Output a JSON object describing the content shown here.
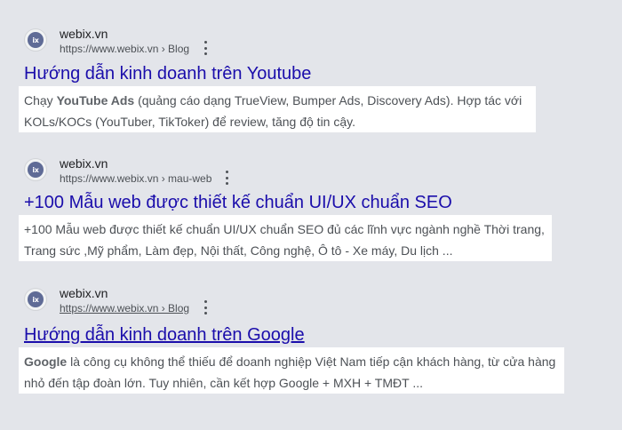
{
  "results": [
    {
      "site_name": "webix.vn",
      "url_text": "https://www.webix.vn › Blog",
      "favicon_text": "ix",
      "title": "Hướng dẫn kinh doanh trên Youtube",
      "snippet": {
        "line1_pre": "Chạy ",
        "line1_bold": "YouTube Ads",
        "line1_post": " (quảng cáo dạng TrueView, Bumper Ads, Discovery Ads). Hợp tác với",
        "line2": "KOLs/KOCs (YouTuber, TikToker) để review, tăng độ tin cậy."
      }
    },
    {
      "site_name": "webix.vn",
      "url_text": "https://www.webix.vn › mau-web",
      "favicon_text": "ix",
      "title": "+100 Mẫu web được thiết kế chuẩn UI/UX chuẩn SEO",
      "snippet": {
        "line1_pre": "+100 Mẫu web được thiết kế chuẩn UI/UX chuẩn SEO đủ các lĩnh vực ngành nghề Thời trang,",
        "line1_bold": "",
        "line1_post": "",
        "line2": "Trang sức ,Mỹ phẩm, Làm đẹp, Nội thất, Công nghệ, Ô tô - Xe máy, Du lịch ..."
      }
    },
    {
      "site_name": "webix.vn",
      "url_text": "https://www.webix.vn › Blog",
      "favicon_text": "ix",
      "title": "Hướng dẫn kinh doanh trên Google",
      "snippet": {
        "line1_pre": "",
        "line1_bold": "Google",
        "line1_post": " là công cụ không thể thiếu để doanh nghiệp Việt Nam tiếp cận khách hàng, từ cửa hàng",
        "line2": "nhỏ đến tập đoàn lớn. Tuy nhiên, cần kết hợp Google + MXH + TMĐT ..."
      }
    }
  ],
  "colors": {
    "background": "#e3e5ea",
    "link": "#1a0dab",
    "text": "#4d5156"
  }
}
